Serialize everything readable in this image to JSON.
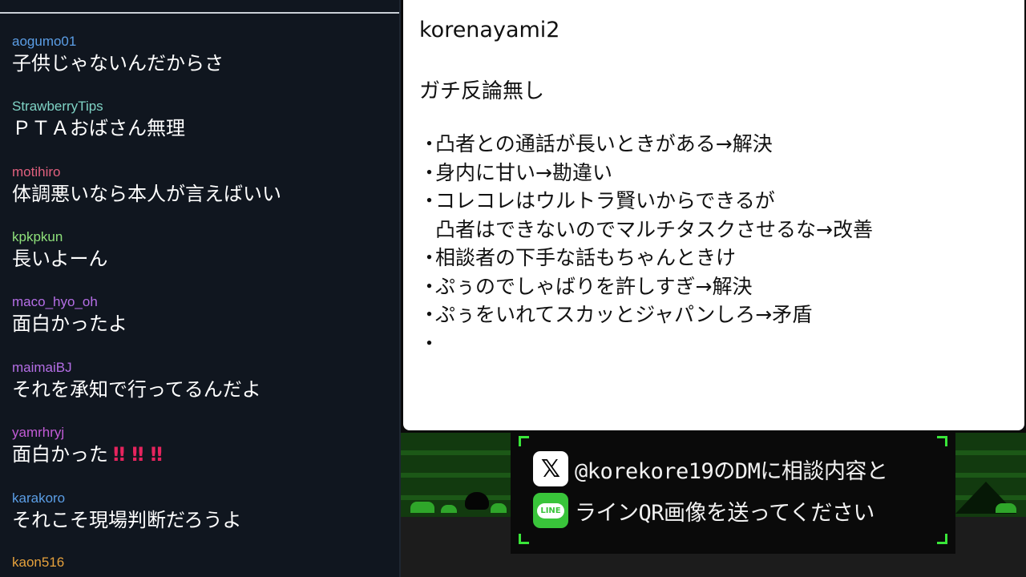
{
  "chat": {
    "messages": [
      {
        "user": "aogumo01",
        "text": "子供じゃないんだからさ",
        "user_color": "#5b9ee6"
      },
      {
        "user": "StrawberryTips",
        "text": "ＰＴＡおばさん無理",
        "user_color": "#7fd3c5"
      },
      {
        "user": "motihiro",
        "text": "体調悪いなら本人が言えばいい",
        "user_color": "#e0607e"
      },
      {
        "user": "kpkpkun",
        "text": "長いよーん",
        "user_color": "#8ee07a"
      },
      {
        "user": "maco_hyo_oh",
        "text": "面白かったよ",
        "user_color": "#b56ee6"
      },
      {
        "user": "maimaiBJ",
        "text": "それを承知で行ってるんだよ",
        "user_color": "#b56ee6"
      },
      {
        "user": "yamrhryj",
        "text": "面白かった",
        "user_color": "#c25bd6",
        "suffix": "‼ ‼ ‼"
      },
      {
        "user": "karakoro",
        "text": "それこそ現場判断だろうよ",
        "user_color": "#5b9ee6"
      },
      {
        "user": "kaon516",
        "text": "",
        "user_color": "#e6a13c"
      }
    ]
  },
  "note": {
    "handle": "korenayami2",
    "heading": "ガチ反論無し",
    "bullet": "・",
    "items": [
      "凸者との通話が長いときがある→解決",
      "身内に甘い→勘違い",
      "コレコレはウルトラ賢いからできるが",
      "凸者はできないのでマルチタスクさせるな→改善",
      "相談者の下手な話もちゃんときけ",
      "ぷぅのでしゃばりを許しすぎ→解決",
      "ぷぅをいれてスカッとジャパンしろ→矛盾",
      ""
    ],
    "continuation_index": 3
  },
  "infobox": {
    "x_icon": "𝕏",
    "x_text": "@korekore19のDMに相談内容と",
    "line_icon": "LINE",
    "line_text": "ラインQR画像を送ってください",
    "accent": "#39e639"
  },
  "colors": {
    "chat_bg": "#10161f",
    "note_bg": "#ffffff",
    "grass": "#123a0f",
    "bang": "#e6245e"
  }
}
